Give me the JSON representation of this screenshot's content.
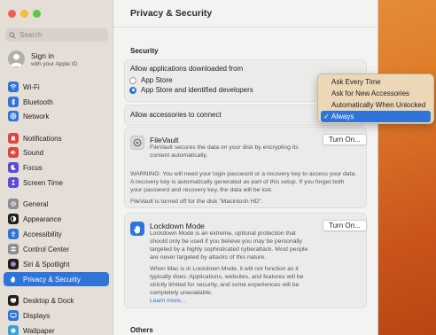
{
  "sidebar": {
    "search_placeholder": "Search",
    "signin": {
      "title": "Sign in",
      "subtitle": "with your Apple ID"
    },
    "items": [
      {
        "label": "Wi-Fi",
        "icon": "wifi-icon",
        "color": "#2f74d8"
      },
      {
        "label": "Bluetooth",
        "icon": "bluetooth-icon",
        "color": "#2f74d8"
      },
      {
        "label": "Network",
        "icon": "globe-icon",
        "color": "#2f74d8"
      },
      {
        "label": "Notifications",
        "icon": "bell-icon",
        "color": "#e0453c"
      },
      {
        "label": "Sound",
        "icon": "speaker-icon",
        "color": "#e0453c"
      },
      {
        "label": "Focus",
        "icon": "moon-icon",
        "color": "#5b4bd6"
      },
      {
        "label": "Screen Time",
        "icon": "hourglass-icon",
        "color": "#5b4bd6"
      },
      {
        "label": "General",
        "icon": "gear-icon",
        "color": "#8e8e92"
      },
      {
        "label": "Appearance",
        "icon": "appearance-icon",
        "color": "#1f1f1f"
      },
      {
        "label": "Accessibility",
        "icon": "accessibility-icon",
        "color": "#2f74d8"
      },
      {
        "label": "Control Center",
        "icon": "control-center-icon",
        "color": "#8e8e92"
      },
      {
        "label": "Siri & Spotlight",
        "icon": "siri-icon",
        "color": "#1f1f1f"
      },
      {
        "label": "Privacy & Security",
        "icon": "hand-icon",
        "color": "#2f74d8"
      },
      {
        "label": "Desktop & Dock",
        "icon": "desktop-icon",
        "color": "#1f1f1f"
      },
      {
        "label": "Displays",
        "icon": "display-icon",
        "color": "#2f74d8"
      },
      {
        "label": "Wallpaper",
        "icon": "wallpaper-icon",
        "color": "#33a4d8"
      }
    ],
    "active_item": "Privacy & Security"
  },
  "main": {
    "title": "Privacy & Security",
    "security_heading": "Security",
    "allow_apps_label": "Allow applications downloaded from",
    "radio_options": [
      "App Store",
      "App Store and identified developers"
    ],
    "radio_selected": "App Store and identified developers",
    "accessories_label": "Allow accessories to connect",
    "filevault": {
      "title": "FileVault",
      "description_1": "FileVault secures the data on your disk by encrypting its",
      "description_2": "content automatically.",
      "button": "Turn On...",
      "warning_1": "WARNING: You will need your login password or a recovery key to access your data.",
      "warning_2": "A recovery key is automatically generated as part of this setup. If you forget both",
      "warning_3": "your password and recovery key, the data will be lost.",
      "status": "FileVault is turned off for the disk \"Macintosh HD\"."
    },
    "lockdown": {
      "title": "Lockdown Mode",
      "lines": [
        "Lockdown Mode is an extreme, optional protection that",
        "should only be used if you believe you may be personally",
        "targeted by a highly sophisticated cyberattack. Most people",
        "are never targeted by attacks of this nature."
      ],
      "lines2": [
        "When Mac is in Lockdown Mode, it will not function as it",
        "typically does. Applications, websites, and features will be",
        "strictly limited for security, and some experiences will be",
        "completely unavailable."
      ],
      "learn_more": "Learn more...",
      "button": "Turn On..."
    },
    "others_heading": "Others"
  },
  "accessories_menu": {
    "options": [
      "Ask Every Time",
      "Ask for New Accessories",
      "Automatically When Unlocked",
      "Always"
    ],
    "selected": "Always"
  }
}
